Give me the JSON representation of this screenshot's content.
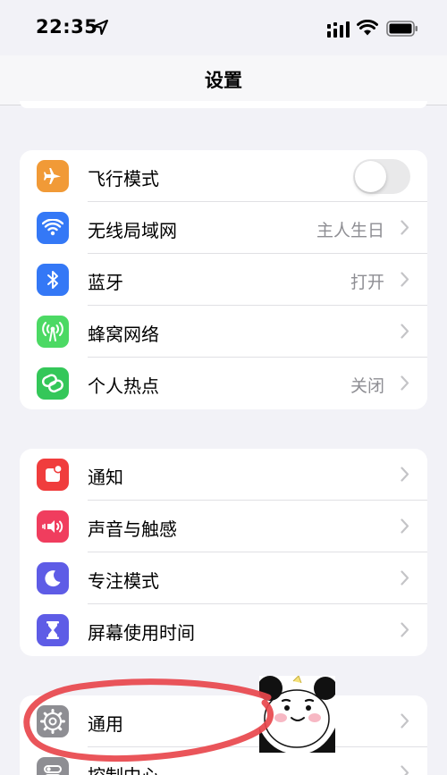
{
  "status_bar": {
    "time": "22:35"
  },
  "nav": {
    "title": "设置"
  },
  "group1": {
    "airplane": {
      "label": "飞行模式",
      "toggle_on": false
    },
    "wifi": {
      "label": "无线局域网",
      "value": "主人生日"
    },
    "bluetooth": {
      "label": "蓝牙",
      "value": "打开"
    },
    "cellular": {
      "label": "蜂窝网络"
    },
    "hotspot": {
      "label": "个人热点",
      "value": "关闭"
    }
  },
  "group2": {
    "notifications": {
      "label": "通知"
    },
    "sounds": {
      "label": "声音与触感"
    },
    "focus": {
      "label": "专注模式"
    },
    "screentime": {
      "label": "屏幕使用时间"
    }
  },
  "group3": {
    "general": {
      "label": "通用"
    },
    "control_center": {
      "label": "控制中心"
    }
  },
  "colors": {
    "airplane": "#f19a37",
    "wifi": "#3478f6",
    "bluetooth": "#3478f6",
    "cellular": "#4cd964",
    "hotspot": "#34c759",
    "notifications": "#f03d3d",
    "sounds": "#f03d5e",
    "focus": "#5e5ce6",
    "screentime": "#5e5ce6",
    "general": "#8e8e93",
    "control_center": "#8e8e93",
    "annotation": "#e8464c"
  }
}
